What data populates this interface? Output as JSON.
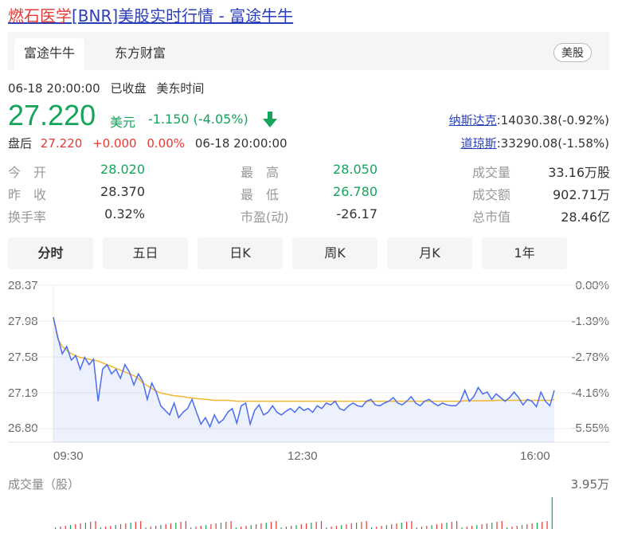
{
  "header": {
    "title_link": "燃石医学",
    "title_rest": "[BNR]美股实时行情 - 富途牛牛"
  },
  "tabs": [
    "富途牛牛",
    "东方财富"
  ],
  "market_badge": "美股",
  "meta": {
    "time": "06-18 20:00:00",
    "status": "已收盘",
    "zone": "美东时间"
  },
  "quote": {
    "price": "27.220",
    "currency": "美元",
    "change": "-1.150 (-4.05%)",
    "color_down": "#14a55a",
    "color_up": "#e53935"
  },
  "after_hours": {
    "label": "盘后",
    "price": "27.220",
    "change": "+0.000",
    "pct": "0.00%",
    "time": "06-18 20:00:00"
  },
  "indices": [
    {
      "name": "纳斯达克",
      "value": ":14030.38(-0.92%)"
    },
    {
      "name": "道琼斯",
      "value": ":33290.08(-1.58%)"
    }
  ],
  "stats": [
    {
      "label": "今　开",
      "value": "28.020"
    },
    {
      "label": "昨　收",
      "value": "28.370"
    },
    {
      "label": "换手率",
      "value": "0.32%"
    },
    {
      "label": "最　高",
      "value": "28.050"
    },
    {
      "label": "最　低",
      "value": "26.780"
    },
    {
      "label": "市盈(动)",
      "value": "-26.17"
    },
    {
      "label": "成交量",
      "value": "33.16万股"
    },
    {
      "label": "成交额",
      "value": "902.71万"
    },
    {
      "label": "总市值",
      "value": "28.46亿"
    }
  ],
  "chart_tabs": [
    "分时",
    "五日",
    "日K",
    "周K",
    "月K",
    "1年"
  ],
  "chart_data": {
    "type": "line",
    "y_ticks": [
      "28.37",
      "27.98",
      "27.58",
      "27.19",
      "26.80"
    ],
    "pct_ticks": [
      "0.00%",
      "-1.39%",
      "-2.78%",
      "-4.16%",
      "-5.55%"
    ],
    "x_ticks": [
      "09:30",
      "12:30",
      "16:00"
    ],
    "ylim": [
      26.8,
      28.37
    ],
    "series": [
      {
        "role": "price",
        "color": "#4a6cf0",
        "values": [
          28.02,
          27.8,
          27.62,
          27.7,
          27.55,
          27.6,
          27.45,
          27.58,
          27.5,
          27.56,
          27.1,
          27.45,
          27.5,
          27.4,
          27.45,
          27.35,
          27.5,
          27.42,
          27.28,
          27.4,
          27.32,
          27.12,
          27.3,
          27.2,
          27.05,
          27.0,
          26.95,
          27.08,
          26.92,
          26.98,
          27.02,
          27.12,
          26.98,
          26.85,
          26.92,
          26.82,
          26.95,
          26.86,
          26.9,
          26.98,
          27.02,
          26.86,
          27.05,
          27.08,
          26.85,
          27.0,
          27.06,
          26.95,
          26.98,
          27.05,
          26.98,
          26.95,
          26.99,
          27.02,
          26.98,
          27.04,
          27.0,
          27.02,
          26.98,
          27.05,
          27.02,
          27.08,
          27.06,
          27.1,
          27.02,
          27.0,
          27.05,
          27.08,
          27.05,
          27.04,
          27.1,
          27.12,
          27.06,
          27.05,
          27.08,
          27.1,
          27.14,
          27.08,
          27.06,
          27.1,
          27.15,
          27.08,
          27.05,
          27.1,
          27.12,
          27.08,
          27.05,
          27.08,
          27.06,
          27.05,
          27.05,
          27.1,
          27.22,
          27.1,
          27.15,
          27.25,
          27.18,
          27.2,
          27.12,
          27.18,
          27.14,
          27.1,
          27.14,
          27.2,
          27.14,
          27.06,
          27.12,
          27.1,
          27.04,
          27.2,
          27.1,
          27.05,
          27.22
        ]
      },
      {
        "role": "average",
        "color": "#f2b632",
        "values": [
          28.02,
          27.78,
          27.7,
          27.66,
          27.62,
          27.6,
          27.58,
          27.57,
          27.56,
          27.55,
          27.54,
          27.52,
          27.5,
          27.48,
          27.46,
          27.44,
          27.42,
          27.4,
          27.38,
          27.35,
          27.3,
          27.27,
          27.24,
          27.21,
          27.19,
          27.18,
          27.17,
          27.16,
          27.155,
          27.15,
          27.14,
          27.135,
          27.13,
          27.125,
          27.12,
          27.115,
          27.11,
          27.11,
          27.11,
          27.11,
          27.105,
          27.1,
          27.1,
          27.1,
          27.1,
          27.1,
          27.1,
          27.1,
          27.1,
          27.1,
          27.1,
          27.1,
          27.1,
          27.1,
          27.1,
          27.1,
          27.1,
          27.1,
          27.1,
          27.1,
          27.1,
          27.1,
          27.1,
          27.1,
          27.1,
          27.1,
          27.1,
          27.1,
          27.1,
          27.1,
          27.1,
          27.1,
          27.1,
          27.1,
          27.1,
          27.1,
          27.1,
          27.1,
          27.1,
          27.1,
          27.1,
          27.1,
          27.1,
          27.1,
          27.1,
          27.1,
          27.1,
          27.1,
          27.1,
          27.1,
          27.1,
          27.1,
          27.105,
          27.105,
          27.105,
          27.105,
          27.105,
          27.105,
          27.105,
          27.11,
          27.11,
          27.11,
          27.11,
          27.11,
          27.11,
          27.11,
          27.11,
          27.11,
          27.11,
          27.11,
          27.11,
          27.11,
          27.12
        ]
      }
    ],
    "volume_label": "成交量（股）",
    "volume_max": "3.95万",
    "volume_color_up": "#e53935",
    "volume_color_down": "#14a55a"
  }
}
